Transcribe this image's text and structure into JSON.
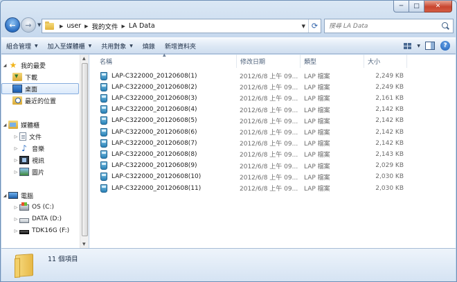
{
  "window": {
    "caption": {
      "minimize": "─",
      "maximize": "□",
      "close": "✕"
    }
  },
  "nav": {
    "back_glyph": "←",
    "forward_glyph": "→",
    "dropdown_glyph": "▼"
  },
  "address": {
    "breadcrumbs": [
      "user",
      "我的文件",
      "LA Data"
    ],
    "separator": "▶",
    "dropdown_glyph": "▼",
    "refresh_glyph": "⟳"
  },
  "search": {
    "placeholder": "搜尋 LA Data",
    "value": ""
  },
  "toolbar": {
    "organize": "組合管理",
    "add_to_library": "加入至媒體櫃",
    "share_with": "共用對象",
    "burn": "燒錄",
    "new_folder": "新增資料夾",
    "arrow": "▼"
  },
  "sidebar": {
    "favorites": "我的最愛",
    "downloads": "下載",
    "desktop": "桌面",
    "recent": "最近的位置",
    "libraries": "媒體櫃",
    "documents": "文件",
    "music": "音樂",
    "videos": "視訊",
    "pictures": "圖片",
    "computer": "電腦",
    "drive_c": "OS (C:)",
    "drive_d": "DATA (D:)",
    "drive_f": "TDK16G (F:)",
    "expanded_glyph": "◢",
    "collapsed_glyph": "▷",
    "star_glyph": "★",
    "music_glyph": "♪"
  },
  "columns": {
    "name": "名稱",
    "modified": "修改日期",
    "type": "類型",
    "size": "大小",
    "sort_glyph": "▲"
  },
  "files": [
    {
      "name": "LAP-C322000_20120608(1)",
      "modified": "2012/6/8 上午 09...",
      "type": "LAP 檔案",
      "size": "2,249 KB"
    },
    {
      "name": "LAP-C322000_20120608(2)",
      "modified": "2012/6/8 上午 09...",
      "type": "LAP 檔案",
      "size": "2,249 KB"
    },
    {
      "name": "LAP-C322000_20120608(3)",
      "modified": "2012/6/8 上午 09...",
      "type": "LAP 檔案",
      "size": "2,161 KB"
    },
    {
      "name": "LAP-C322000_20120608(4)",
      "modified": "2012/6/8 上午 09...",
      "type": "LAP 檔案",
      "size": "2,142 KB"
    },
    {
      "name": "LAP-C322000_20120608(5)",
      "modified": "2012/6/8 上午 09...",
      "type": "LAP 檔案",
      "size": "2,142 KB"
    },
    {
      "name": "LAP-C322000_20120608(6)",
      "modified": "2012/6/8 上午 09...",
      "type": "LAP 檔案",
      "size": "2,142 KB"
    },
    {
      "name": "LAP-C322000_20120608(7)",
      "modified": "2012/6/8 上午 09...",
      "type": "LAP 檔案",
      "size": "2,142 KB"
    },
    {
      "name": "LAP-C322000_20120608(8)",
      "modified": "2012/6/8 上午 09...",
      "type": "LAP 檔案",
      "size": "2,143 KB"
    },
    {
      "name": "LAP-C322000_20120608(9)",
      "modified": "2012/6/8 上午 09...",
      "type": "LAP 檔案",
      "size": "2,029 KB"
    },
    {
      "name": "LAP-C322000_20120608(10)",
      "modified": "2012/6/8 上午 09...",
      "type": "LAP 檔案",
      "size": "2,030 KB"
    },
    {
      "name": "LAP-C322000_20120608(11)",
      "modified": "2012/6/8 上午 09...",
      "type": "LAP 檔案",
      "size": "2,030 KB"
    }
  ],
  "details": {
    "item_count": "11 個項目"
  },
  "colors": {
    "accent": "#1d5fb7",
    "close": "#c8452f",
    "selection_border": "#84acdd"
  }
}
